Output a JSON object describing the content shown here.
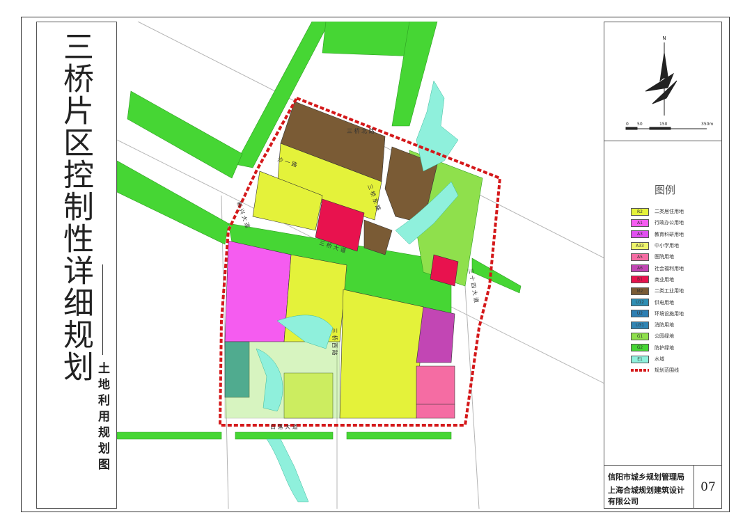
{
  "title": "三桥片区控制性详细规划",
  "subtitle": "土地利用规划图",
  "north_label": "N",
  "scale": {
    "ticks": [
      "0",
      "50",
      "150",
      "350m"
    ]
  },
  "legend_title": "图例",
  "legend": [
    {
      "code": "R2",
      "label": "二类居住用地",
      "color": "#e4f23a"
    },
    {
      "code": "A1",
      "label": "行政办公用地",
      "color": "#f55cf0"
    },
    {
      "code": "A3",
      "label": "教育科研用地",
      "color": "#e14ff0"
    },
    {
      "code": "A33",
      "label": "中小学用地",
      "color": "#eef56c"
    },
    {
      "code": "A5",
      "label": "医院用地",
      "color": "#f56ca3"
    },
    {
      "code": "A6",
      "label": "社会福利用地",
      "color": "#c246b4"
    },
    {
      "code": "B1",
      "label": "商业用地",
      "color": "#e8124e"
    },
    {
      "code": "M2",
      "label": "二类工业用地",
      "color": "#7a5b35"
    },
    {
      "code": "U12",
      "label": "供电用地",
      "color": "#2f8fb4"
    },
    {
      "code": "U2",
      "label": "环境设施用地",
      "color": "#2d7fb3"
    },
    {
      "code": "U31",
      "label": "消防用地",
      "color": "#3286b5"
    },
    {
      "code": "G1",
      "label": "公园绿地",
      "color": "#8fe04c"
    },
    {
      "code": "G2",
      "label": "防护绿地",
      "color": "#46d634"
    },
    {
      "code": "E1",
      "label": "水域",
      "color": "#8ff0dc"
    },
    {
      "code": "",
      "label": "规划范围线",
      "color": "#d4181a"
    }
  ],
  "roads": {
    "north_road": "三 桥 北 路",
    "west_road": "新 兴 大 道",
    "east_road": "三 十 四 大 道",
    "south_road": "白 落 大 道",
    "center_road": "三 桥 西 路",
    "mid_road": "三 桥 大 道",
    "mid_road2": "三 桥 东 路",
    "small_road": "沙 一 路"
  },
  "organizations": {
    "org1": "信阳市城乡规划管理局",
    "org2": "上海合城规划建筑设计有限公司"
  },
  "page_number": "07"
}
